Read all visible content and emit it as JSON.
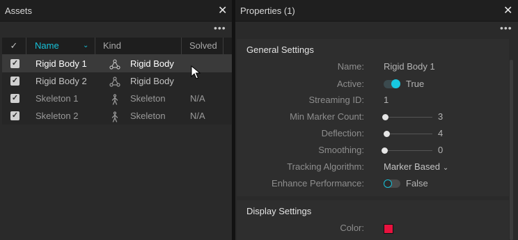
{
  "assets": {
    "title": "Assets",
    "close_glyph": "✕",
    "menu_glyph": "•••",
    "columns": {
      "check": "✓",
      "name": "Name",
      "kind": "Kind",
      "solved": "Solved",
      "sort_glyph": "⌄"
    },
    "rows": [
      {
        "name": "Rigid Body 1",
        "kind": "Rigid Body",
        "kind_icon": "rigid-body-icon",
        "solved": "",
        "checked": true,
        "selected": true
      },
      {
        "name": "Rigid Body 2",
        "kind": "Rigid Body",
        "kind_icon": "rigid-body-icon",
        "solved": "",
        "checked": true,
        "selected": false
      },
      {
        "name": "Skeleton 1",
        "kind": "Skeleton",
        "kind_icon": "skeleton-icon",
        "solved": "N/A",
        "checked": true,
        "selected": false
      },
      {
        "name": "Skeleton 2",
        "kind": "Skeleton",
        "kind_icon": "skeleton-icon",
        "solved": "N/A",
        "checked": true,
        "selected": false
      }
    ],
    "check_glyph": "✓"
  },
  "properties": {
    "title": "Properties (1)",
    "close_glyph": "✕",
    "menu_glyph": "•••",
    "general": {
      "title": "General Settings",
      "name_label": "Name:",
      "name_value": "Rigid Body 1",
      "active_label": "Active:",
      "active_value": "True",
      "streaming_label": "Streaming ID:",
      "streaming_value": "1",
      "min_marker_label": "Min Marker Count:",
      "min_marker_value": "3",
      "deflection_label": "Deflection:",
      "deflection_value": "4",
      "smoothing_label": "Smoothing:",
      "smoothing_value": "0",
      "tracking_label": "Tracking Algorithm:",
      "tracking_value": "Marker Based",
      "enhance_label": "Enhance Performance:",
      "enhance_value": "False"
    },
    "display": {
      "title": "Display Settings",
      "color_label": "Color:",
      "color_value": "#e8123e"
    }
  },
  "colors": {
    "accent": "#17c1d8",
    "background": "#2a2a2a"
  }
}
